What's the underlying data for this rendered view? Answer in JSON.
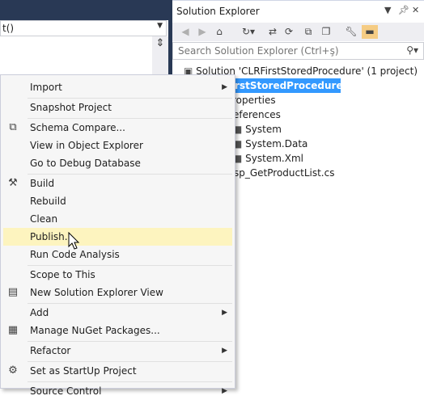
{
  "editor": {
    "dropdown_text": "t()"
  },
  "solution_explorer": {
    "title": "Solution Explorer",
    "search_placeholder": "Search Solution Explorer (Ctrl+ş)",
    "tree": {
      "solution": "Solution 'CLRFirstStoredProcedure' (1 project)",
      "project": "irstStoredProcedure",
      "properties": "roperties",
      "references": "eferences",
      "ref_system": "System",
      "ref_system_data": "System.Data",
      "ref_system_xml": "System.Xml",
      "file": "sp_GetProductList.cs"
    }
  },
  "context_menu": {
    "import": "Import",
    "snapshot_project": "Snapshot Project",
    "schema_compare": "Schema Compare...",
    "view_in_object_explorer": "View in Object Explorer",
    "go_to_debug_database": "Go to Debug Database",
    "build": "Build",
    "rebuild": "Rebuild",
    "clean": "Clean",
    "publish": "Publish...",
    "run_code_analysis": "Run Code Analysis",
    "scope_to_this": "Scope to This",
    "new_solution_explorer_view": "New Solution Explorer View",
    "add": "Add",
    "manage_nuget_packages": "Manage NuGet Packages...",
    "refactor": "Refactor",
    "set_as_startup_project": "Set as StartUp Project",
    "source_control": "Source Control"
  },
  "colors": {
    "selection": "#3399ff",
    "hover": "#fdf4bf",
    "dark_chrome": "#293955",
    "pin_active": "#f5cc84"
  }
}
